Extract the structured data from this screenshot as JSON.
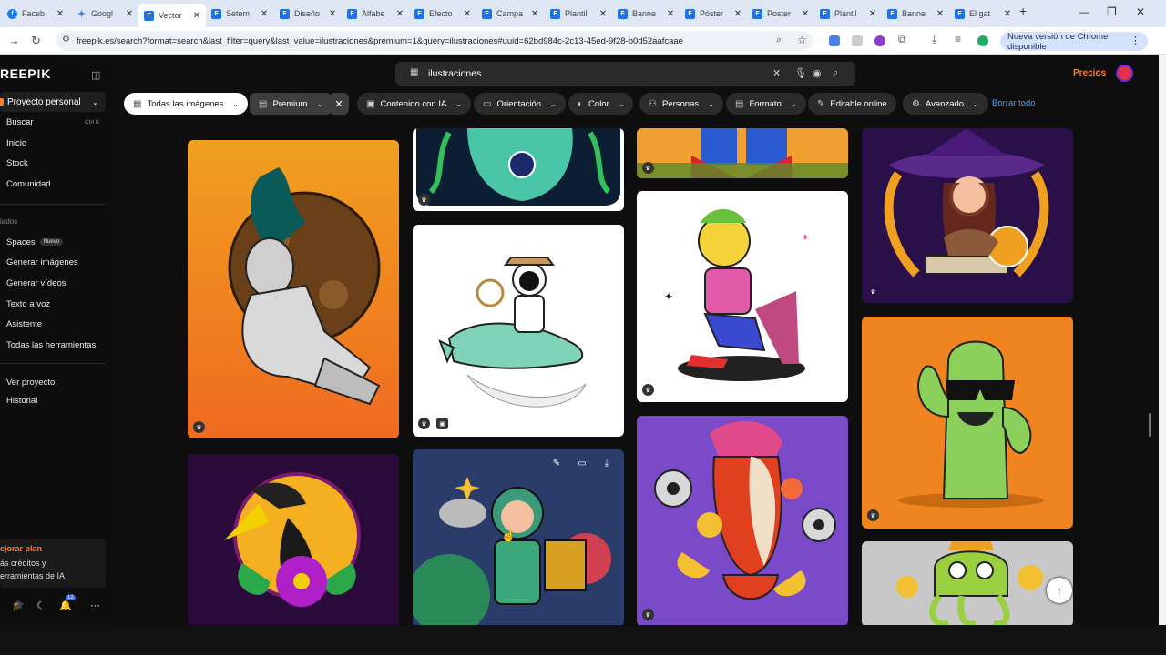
{
  "browser": {
    "tabs": [
      {
        "label": "Faceb",
        "icon": "facebook-icon",
        "kind": "fb"
      },
      {
        "label": "Googl",
        "icon": "google-icon",
        "kind": "g"
      },
      {
        "label": "Vector",
        "icon": "freepik-icon",
        "kind": "f",
        "active": true
      },
      {
        "label": "Setem",
        "icon": "freepik-icon",
        "kind": "f"
      },
      {
        "label": "Diseño",
        "icon": "freepik-icon",
        "kind": "f"
      },
      {
        "label": "Alfabe",
        "icon": "freepik-icon",
        "kind": "f"
      },
      {
        "label": "Efecto",
        "icon": "freepik-icon",
        "kind": "f"
      },
      {
        "label": "Campa",
        "icon": "freepik-icon",
        "kind": "f"
      },
      {
        "label": "Plantil",
        "icon": "freepik-icon",
        "kind": "f"
      },
      {
        "label": "Banne",
        "icon": "freepik-icon",
        "kind": "f"
      },
      {
        "label": "Póster",
        "icon": "freepik-icon",
        "kind": "f"
      },
      {
        "label": "Poster",
        "icon": "freepik-icon",
        "kind": "f"
      },
      {
        "label": "Plantil",
        "icon": "freepik-icon",
        "kind": "f"
      },
      {
        "label": "Banne",
        "icon": "freepik-icon",
        "kind": "f"
      },
      {
        "label": "El gat",
        "icon": "freepik-icon",
        "kind": "f"
      }
    ],
    "url": "freepik.es/search?format=search&last_filter=query&last_value=ilustraciones&premium=1&query=ilustraciones#uuid=62bd984c-2c13-45ed-9f28-b0d52aafcaae",
    "update_label": "Nueva versión de Chrome disponible"
  },
  "sidebar": {
    "logo": "REEP!K",
    "project": "Proyecto personal",
    "nav": [
      {
        "label": "Buscar",
        "shortcut": "Ctrl K"
      },
      {
        "label": "Inicio"
      },
      {
        "label": "Stock"
      },
      {
        "label": "Comunidad"
      }
    ],
    "section_label": "iados",
    "tools": [
      {
        "label": "Spaces",
        "badge": "Nuevo"
      },
      {
        "label": "Generar imágenes"
      },
      {
        "label": "Generar vídeos"
      },
      {
        "label": "Texto a voz"
      },
      {
        "label": "Asistente"
      },
      {
        "label": "Todas las herramientas"
      }
    ],
    "extra": [
      {
        "label": "Ver proyecto"
      },
      {
        "label": "Historial"
      }
    ],
    "upgrade": {
      "title": "ejorar plan",
      "line1": "ás créditos y",
      "line2": "erramientas de IA"
    },
    "notifications_count": "12"
  },
  "topbar": {
    "search_value": "ilustraciones",
    "pricing_label": "Precios"
  },
  "filters": {
    "all_images": "Todas las imágenes",
    "premium": "Premium",
    "ai_content": "Contenido con IA",
    "orientation": "Orientación",
    "color": "Color",
    "people": "Personas",
    "format": "Formato",
    "editable": "Editable online",
    "advanced": "Avanzado",
    "clear_all": "Borrar todo"
  },
  "colors": {
    "accent": "#ff7a2f",
    "link": "#4a9fff",
    "background": "#0e0e0e"
  }
}
